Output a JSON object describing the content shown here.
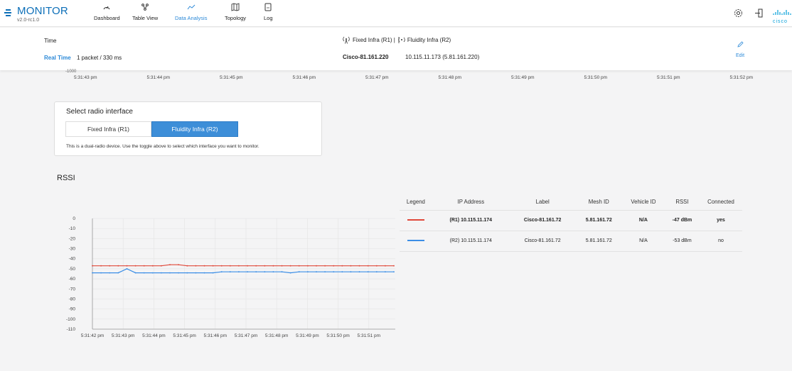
{
  "app": {
    "title": "MONITOR",
    "version": "v2.0-rc1.0"
  },
  "nav": [
    {
      "label": "Dashboard",
      "icon": "gauge-icon",
      "active": false
    },
    {
      "label": "Table View",
      "icon": "network-icon",
      "active": false
    },
    {
      "label": "Data Analysis",
      "icon": "chart-line-icon",
      "active": true
    },
    {
      "label": "Topology",
      "icon": "map-icon",
      "active": false
    },
    {
      "label": "Log",
      "icon": "log-file-icon",
      "active": false
    }
  ],
  "header_icons": [
    "settings-icon",
    "logout-icon",
    "cisco-logo"
  ],
  "brand_logo_text": "cisco",
  "header": {
    "time_label": "Time",
    "realtime_label": "Real Time",
    "realtime_value": "1 packet / 330 ms",
    "radio_r1": "Fixed Infra (R1) |",
    "radio_r2": "Fluidity Infra (R2)",
    "device_name": "Cisco-81.161.220",
    "device_ips": "10.115.11.173  (5.81.161.220)",
    "edit_label": "Edit"
  },
  "upper_chart": {
    "partial_tick": "-1000",
    "x_ticks": [
      "5:31:43 pm",
      "5:31:44 pm",
      "5:31:45 pm",
      "5:31:46 pm",
      "5:31:47 pm",
      "5:31:48 pm",
      "5:31:49 pm",
      "5:31:50 pm",
      "5:31:51 pm",
      "5:31:52 pm"
    ]
  },
  "radio_select": {
    "title": "Select radio interface",
    "options": [
      "Fixed Infra (R1)",
      "Fluidity Infra (R2)"
    ],
    "selected": "Fluidity Infra (R2)",
    "help": "This is a dual-radio device. Use the toggle above to select which interface you want to monitor."
  },
  "rssi": {
    "title": "RSSI"
  },
  "legend_table": {
    "headers": [
      "Legend",
      "IP Address",
      "Label",
      "Mesh ID",
      "Vehicle ID",
      "RSSI",
      "Connected"
    ],
    "rows": [
      {
        "color": "#e0483a",
        "ip": "(R1)  10.115.11.174",
        "label": "Cisco-81.161.72",
        "mesh": "5.81.161.72",
        "vehicle": "N/A",
        "rssi": "-47 dBm",
        "connected": "yes"
      },
      {
        "color": "#3b8ee6",
        "ip": "(R2)  10.115.11.174",
        "label": "Cisco-81.161.72",
        "mesh": "5.81.161.72",
        "vehicle": "N/A",
        "rssi": "-53 dBm",
        "connected": "no"
      }
    ]
  },
  "chart_data": {
    "type": "line",
    "ylim": [
      -110,
      0
    ],
    "y_ticks": [
      "0",
      "-10",
      "-20",
      "-30",
      "-40",
      "-50",
      "-60",
      "-70",
      "-80",
      "-90",
      "-100",
      "-110"
    ],
    "x": [
      "5:31:42 pm",
      "5:31:43 pm",
      "5:31:44 pm",
      "5:31:45 pm",
      "5:31:46 pm",
      "5:31:47 pm",
      "5:31:48 pm",
      "5:31:49 pm",
      "5:31:50 pm",
      "5:31:51 pm"
    ],
    "grid": true,
    "series": [
      {
        "color": "#e0483a",
        "values": [
          -47,
          -47,
          -47,
          -47,
          -47,
          -47,
          -47,
          -47,
          -47,
          -46,
          -46,
          -47,
          -47,
          -47,
          -47,
          -47,
          -47,
          -47,
          -47,
          -47,
          -47,
          -47,
          -47,
          -47,
          -47,
          -47,
          -47,
          -47,
          -47,
          -47,
          -47,
          -47,
          -47,
          -47,
          -47,
          -47
        ]
      },
      {
        "color": "#3b8ee6",
        "values": [
          -54,
          -54,
          -54,
          -54,
          -50,
          -54,
          -54,
          -54,
          -54,
          -54,
          -54,
          -54,
          -54,
          -54,
          -54,
          -53,
          -53,
          -53,
          -53,
          -53,
          -53,
          -53,
          -53,
          -54,
          -53,
          -53,
          -53,
          -53,
          -53,
          -53,
          -53,
          -53,
          -53,
          -53,
          -53,
          -53
        ]
      }
    ]
  }
}
